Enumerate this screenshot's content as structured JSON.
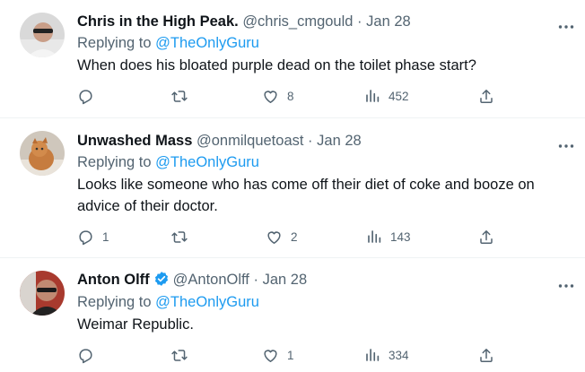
{
  "tweets": [
    {
      "name": "Chris in the High Peak.",
      "handle": "@chris_cmgould",
      "date": "Jan 28",
      "replying_prefix": "Replying to",
      "replying_to": "@TheOnlyGuru",
      "text": "When does his bloated purple dead on the toilet phase start?",
      "replies": "",
      "retweets": "",
      "likes": "8",
      "views": "452",
      "verified": false
    },
    {
      "name": "Unwashed Mass",
      "handle": "@onmilquetoast",
      "date": "Jan 28",
      "replying_prefix": "Replying to",
      "replying_to": "@TheOnlyGuru",
      "text": "Looks like someone who has come off their diet of coke and booze on advice of their doctor.",
      "replies": "1",
      "retweets": "",
      "likes": "2",
      "views": "143",
      "verified": false
    },
    {
      "name": "Anton Olff",
      "handle": "@AntonOlff",
      "date": "Jan 28",
      "replying_prefix": "Replying to",
      "replying_to": "@TheOnlyGuru",
      "text": "Weimar Republic.",
      "replies": "",
      "retweets": "",
      "likes": "1",
      "views": "334",
      "verified": true
    }
  ],
  "separator": "·",
  "colors": {
    "accent": "#1d9bf0",
    "muted": "#536471",
    "text": "#0f1419",
    "divider": "#eff3f4"
  },
  "icons": [
    "reply-icon",
    "retweet-icon",
    "like-icon",
    "views-icon",
    "share-icon",
    "more-icon",
    "verified-badge-icon"
  ]
}
